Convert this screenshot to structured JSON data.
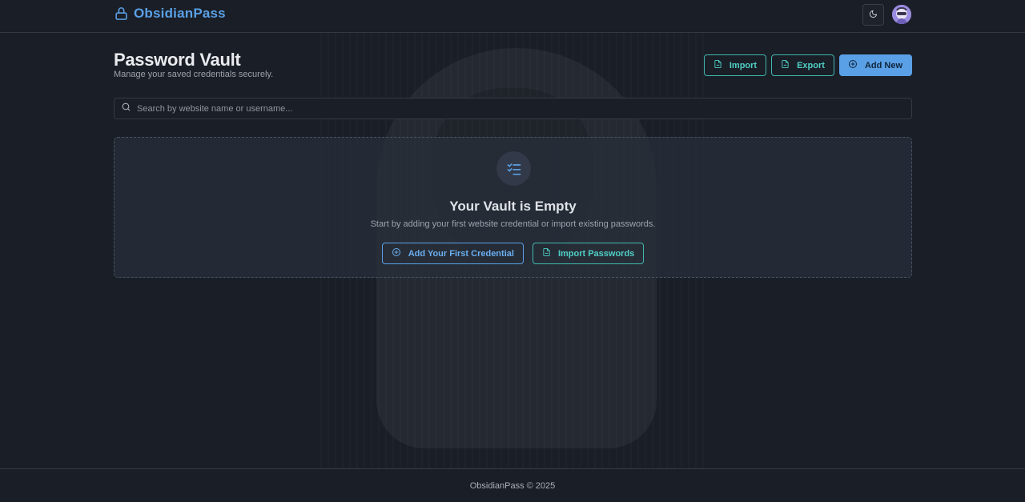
{
  "app": {
    "name": "ObsidianPass",
    "brand_color": "#5aa0e6",
    "accent_color": "#4fcfc6",
    "logo_icon": "lock-icon"
  },
  "header": {
    "theme_toggle_icon": "moon-icon",
    "avatar_icon": "avatar"
  },
  "page": {
    "title": "Password Vault",
    "subtitle": "Manage your saved credentials securely."
  },
  "toolbar": {
    "import_label": "Import",
    "export_label": "Export",
    "add_new_label": "Add New"
  },
  "search": {
    "placeholder": "Search by website name or username...",
    "value": ""
  },
  "empty_state": {
    "icon": "list-checks-icon",
    "title": "Your Vault is Empty",
    "description": "Start by adding your first website credential or import existing passwords.",
    "add_first_label": "Add Your First Credential",
    "import_passwords_label": "Import Passwords"
  },
  "footer": {
    "text": "ObsidianPass © 2025"
  }
}
